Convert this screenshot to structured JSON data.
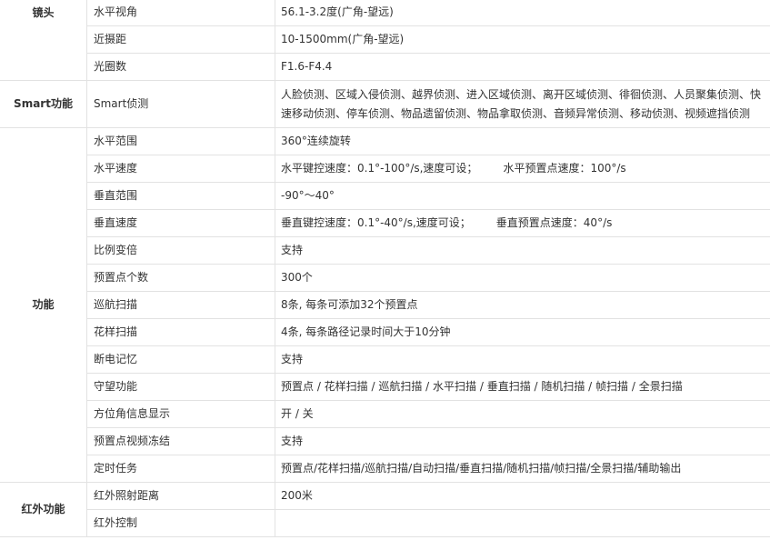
{
  "categories": {
    "lens": "镜头",
    "smart": "Smart功能",
    "function": "功能",
    "infrared": "红外功能"
  },
  "rows": {
    "h_view_angle": {
      "name": "水平视角",
      "value": "56.1-3.2度(广角-望远)"
    },
    "min_focus": {
      "name": "近摄距",
      "value": "10-1500mm(广角-望远)"
    },
    "aperture": {
      "name": "光圈数",
      "value": "F1.6-F4.4"
    },
    "smart_detect": {
      "name": "Smart侦测",
      "value": "人脸侦测、区域入侵侦测、越界侦测、进入区域侦测、离开区域侦测、徘徊侦测、人员聚集侦测、快速移动侦测、停车侦测、物品遗留侦测、物品拿取侦测、音频异常侦测、移动侦测、视频遮挡侦测"
    },
    "h_range": {
      "name": "水平范围",
      "value": "360°连续旋转"
    },
    "h_speed": {
      "name": "水平速度",
      "value_a": "水平键控速度：0.1°-100°/s,速度可设；",
      "value_b": "水平预置点速度：100°/s"
    },
    "v_range": {
      "name": "垂直范围",
      "value": "-90°～40°"
    },
    "v_speed": {
      "name": "垂直速度",
      "value_a": "垂直键控速度：0.1°-40°/s,速度可设；",
      "value_b": "垂直预置点速度：40°/s"
    },
    "prop_zoom": {
      "name": "比例变倍",
      "value": "支持"
    },
    "preset_count": {
      "name": "预置点个数",
      "value": "300个"
    },
    "cruise": {
      "name": "巡航扫描",
      "value": "8条, 每条可添加32个预置点"
    },
    "pattern": {
      "name": "花样扫描",
      "value": "4条, 每条路径记录时间大于10分钟"
    },
    "power_memory": {
      "name": "断电记忆",
      "value": "支持"
    },
    "park": {
      "name": "守望功能",
      "value": "预置点 / 花样扫描 / 巡航扫描 / 水平扫描 / 垂直扫描 / 随机扫描 / 帧扫描 / 全景扫描"
    },
    "azimuth": {
      "name": "方位角信息显示",
      "value": "开 / 关"
    },
    "preset_freeze": {
      "name": "预置点视频冻结",
      "value": "支持"
    },
    "schedule": {
      "name": "定时任务",
      "value": "预置点/花样扫描/巡航扫描/自动扫描/垂直扫描/随机扫描/帧扫描/全景扫描/辅助输出"
    },
    "ir_distance": {
      "name": "红外照射距离",
      "value": "200米"
    },
    "ir_control": {
      "name": "红外控制",
      "value": ""
    }
  }
}
